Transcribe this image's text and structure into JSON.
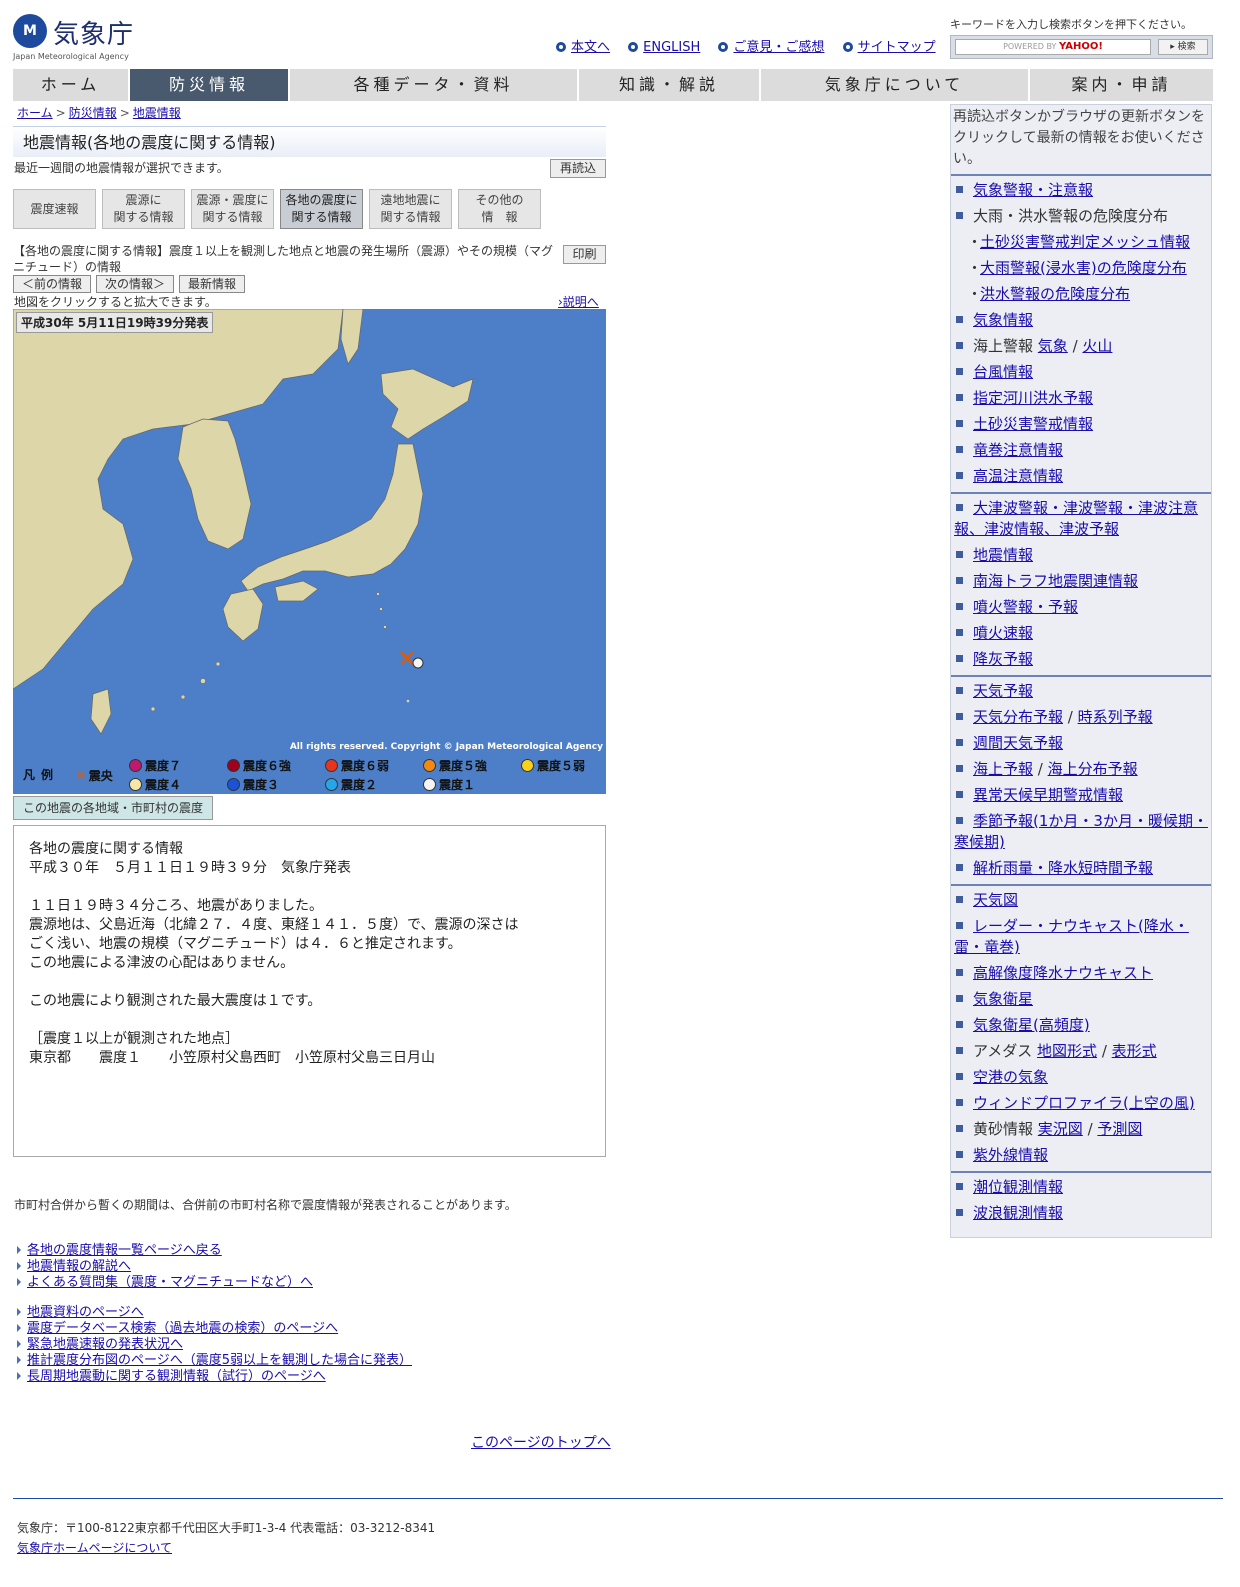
{
  "header": {
    "logo_mark": "M",
    "logo_name": "気象庁",
    "logo_eng": "Japan Meteorological Agency",
    "links": [
      "本文へ",
      "ENGLISH",
      "ご意見・ご感想",
      "サイトマップ"
    ],
    "search_hint": "キーワードを入力し検索ボタンを押下ください。",
    "search_powered": "POWERED BY",
    "search_brand": "YAHOO!",
    "search_button": "▸ 検索"
  },
  "gnav": [
    "ホーム",
    "防災情報",
    "各種データ・資料",
    "知識・解説",
    "気象庁について",
    "案内・申請"
  ],
  "breadcrumb": [
    "ホーム",
    "防災情報",
    "地震情報"
  ],
  "page": {
    "title": "地震情報(各地の震度に関する情報)",
    "subtitle": "最近一週間の地震情報が選択できます。",
    "reload": "再読込",
    "tabs": [
      "震度速報",
      "震源に\n関する情報",
      "震源・震度に\n関する情報",
      "各地の震度に\n関する情報",
      "遠地地震に\n関する情報",
      "その他の\n情　報"
    ],
    "description": "【各地の震度に関する情報】震度１以上を観測した地点と地震の発生場所（震源）やその規模（マグニチュード）の情報",
    "print": "印刷",
    "nav_buttons": [
      "＜前の情報",
      "次の情報＞",
      "最新情報"
    ],
    "map_hint": "地図をクリックすると拡大できます。",
    "explain": "›説明へ",
    "map_stamp": "平成30年 5月11日19時39分発表",
    "map_copyright": "All rights reserved. Copyright © Japan Meteorological Agency",
    "area_tab": "この地震の各地域・市町村の震度"
  },
  "legend": {
    "title": "凡例",
    "epicenter": "震央",
    "items": [
      {
        "label": "震度７",
        "color": "#c0186e"
      },
      {
        "label": "震度６強",
        "color": "#a0001e"
      },
      {
        "label": "震度６弱",
        "color": "#e8341c"
      },
      {
        "label": "震度５強",
        "color": "#f08a14"
      },
      {
        "label": "震度５弱",
        "color": "#f8d21a"
      },
      {
        "label": "震度４",
        "color": "#f8e6a6"
      },
      {
        "label": "震度３",
        "color": "#1c52d8"
      },
      {
        "label": "震度２",
        "color": "#26a6e6"
      },
      {
        "label": "震度１",
        "color": "#f4f4f4"
      }
    ]
  },
  "info_text": "各地の震度に関する情報\n平成３０年　５月１１日１９時３９分　気象庁発表\n\n１１日１９時３４分ころ、地震がありました。\n震源地は、父島近海（北緯２７．４度、東経１４１．５度）で、震源の深さは\nごく浅い、地震の規模（マグニチュード）は４．６と推定されます。\nこの地震による津波の心配はありません。\n\nこの地震により観測された最大震度は１です。\n\n［震度１以上が観測された地点］\n東京都　　震度１　　小笠原村父島西町　小笠原村父島三日月山",
  "merge_note": "市町村合併から暫くの期間は、合併前の市町村名称で震度情報が発表されることがあります。",
  "links_a": [
    "各地の震度情報一覧ページへ戻る",
    "地震情報の解説へ",
    "よくある質問集（震度・マグニチュードなど）へ"
  ],
  "links_b": [
    "地震資料のページへ",
    "震度データベース検索（過去地震の検索）のページへ",
    "緊急地震速報の発表状況へ",
    "推計震度分布図のページへ（震度5弱以上を観測した場合に発表）",
    "長周期地震動に関する観測情報（試行）のページへ"
  ],
  "page_top": "このページのトップへ",
  "footer": {
    "address": "気象庁：〒100-8122東京都千代田区大手町1-3-4 代表電話：03-3212-8341",
    "about": "気象庁ホームページについて"
  },
  "right_menu": {
    "note": "再読込ボタンかブラウザの更新ボタンをクリックして最新の情報をお使いください。",
    "group1": [
      {
        "t": "気象警報・注意報",
        "link": true
      },
      {
        "t": "大雨・洪水警報の危険度分布",
        "link": false
      },
      {
        "t": "土砂災害警戒判定メッシュ情報",
        "sub": true
      },
      {
        "t": "大雨警報(浸水害)の危険度分布",
        "sub": true
      },
      {
        "t": "洪水警報の危険度分布",
        "sub": true
      },
      {
        "t": "気象情報",
        "link": true
      },
      {
        "t": "海上警報",
        "link": false,
        "extra": [
          "気象",
          "火山"
        ]
      },
      {
        "t": "台風情報",
        "link": true
      },
      {
        "t": "指定河川洪水予報",
        "link": true
      },
      {
        "t": "土砂災害警戒情報",
        "link": true
      },
      {
        "t": "竜巻注意情報",
        "link": true
      },
      {
        "t": "高温注意情報",
        "link": true
      }
    ],
    "group2": [
      "大津波警報・津波警報・津波注意報、津波情報、津波予報",
      "地震情報",
      "南海トラフ地震関連情報",
      "噴火警報・予報",
      "噴火速報",
      "降灰予報"
    ],
    "group3": [
      {
        "t": "天気予報"
      },
      {
        "t": "天気分布予報",
        "extra": [
          "時系列予報"
        ]
      },
      {
        "t": "週間天気予報"
      },
      {
        "t": "海上予報",
        "extra": [
          "海上分布予報"
        ]
      },
      {
        "t": "異常天候早期警戒情報"
      },
      {
        "t": "季節予報(1か月・3か月・暖候期・寒候期)"
      },
      {
        "t": "解析雨量・降水短時間予報"
      }
    ],
    "group4": [
      {
        "t": "天気図",
        "link": true
      },
      {
        "t": "レーダー・ナウキャスト(降水・雷・竜巻)",
        "link": true
      },
      {
        "t": "高解像度降水ナウキャスト",
        "link": true
      },
      {
        "t": "気象衛星",
        "link": true
      },
      {
        "t": "気象衛星(高頻度)",
        "link": true
      },
      {
        "t": "アメダス",
        "link": false,
        "extra": [
          "地図形式",
          "表形式"
        ]
      },
      {
        "t": "空港の気象",
        "link": true
      },
      {
        "t": "ウィンドプロファイラ(上空の風)",
        "link": true
      },
      {
        "t": "黄砂情報",
        "link": false,
        "extra": [
          "実況図",
          "予測図"
        ]
      },
      {
        "t": "紫外線情報",
        "link": true
      }
    ],
    "group5": [
      "潮位観測情報",
      "波浪観測情報"
    ]
  }
}
